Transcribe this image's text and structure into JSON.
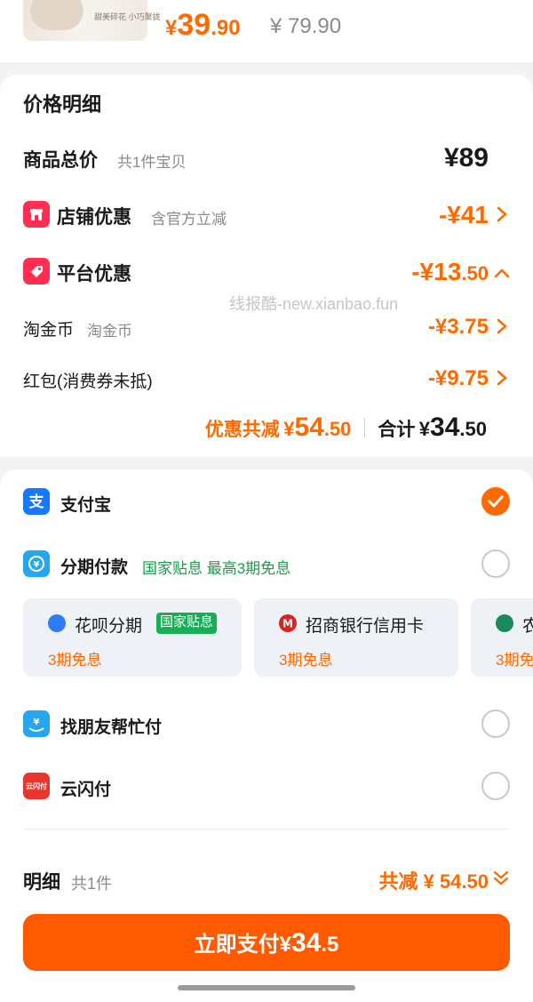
{
  "product": {
    "thumb_text": "甜美碎花 小巧聚拢",
    "price_int": "39",
    "price_dec": ".90",
    "price_yen": "¥",
    "original_price": "¥ 79.90"
  },
  "price_detail": {
    "title": "价格明细",
    "total": {
      "label": "商品总价",
      "sub": "共1件宝贝",
      "amount": "¥89"
    },
    "shop": {
      "label": "店铺优惠",
      "sub": "含官方立减",
      "amount": "-¥41",
      "icon": "shop-icon"
    },
    "platform": {
      "label": "平台优惠",
      "amount_int": "-¥13",
      "amount_dec": ".50",
      "icon": "tag-icon"
    },
    "taojinbi": {
      "label": "淘金币",
      "sub": "淘金币",
      "amount": "-¥3.75"
    },
    "hongbao": {
      "label": "红包(消费券未抵)",
      "amount": "-¥9.75"
    },
    "summary": {
      "discount_label": "优惠共减",
      "discount_yen": "¥",
      "discount_int": "54",
      "discount_dec": ".50",
      "total_label": "合计",
      "total_yen": "¥",
      "total_int": "34",
      "total_dec": ".50"
    }
  },
  "watermark": "线报酷-new.xianbao.fun",
  "payment": {
    "alipay": {
      "label": "支付宝",
      "selected": true,
      "icon": "alipay-icon"
    },
    "installment": {
      "label": "分期付款",
      "tag": "国家贴息 最高3期免息",
      "icon": "installment-icon"
    },
    "installment_options": [
      {
        "name": "花呗分期",
        "badge": "国家贴息",
        "free": "3期免息",
        "icon": "huabei-icon"
      },
      {
        "name": "招商银行信用卡",
        "free": "3期免息",
        "icon": "cmb-icon"
      },
      {
        "name": "农",
        "free": "3期免",
        "icon": "abc-icon"
      }
    ],
    "friend": {
      "label": "找朋友帮忙付",
      "icon": "friend-pay-icon"
    },
    "unionpay": {
      "label": "云闪付",
      "icon": "unionpay-icon",
      "icon_text": "云闪付"
    }
  },
  "footer": {
    "detail_label": "明细",
    "detail_count": "共1件",
    "saved": "共减 ¥ 54.50",
    "pay_button_prefix": "立即支付¥",
    "pay_button_int": "34",
    "pay_button_dec": ".5"
  },
  "colors": {
    "accent": "#ff6a00",
    "button": "#ff5a00",
    "green": "#1a9d4a",
    "red": "#ff2d4f",
    "alipay_blue": "#1677ff"
  }
}
